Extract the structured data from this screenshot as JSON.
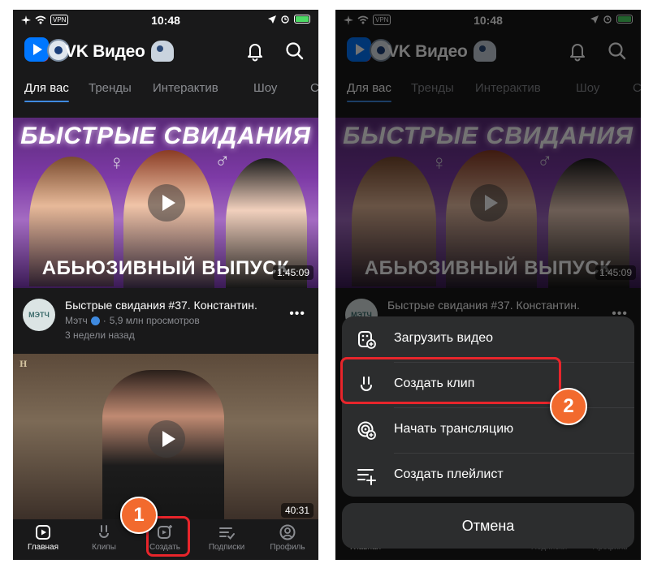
{
  "status": {
    "vpn": "VPN",
    "time": "10:48"
  },
  "header": {
    "brand": "VK Видео"
  },
  "tabs": [
    {
      "label": "Для вас",
      "active": true
    },
    {
      "label": "Тренды"
    },
    {
      "label": "Интерактив"
    },
    {
      "label": "Шоу"
    },
    {
      "label": "С"
    }
  ],
  "video1": {
    "thumb_title": "БЫСТРЫЕ СВИДАНИЯ",
    "thumb_sub": "АБЬЮЗИВНЫЙ ВЫПУСК",
    "duration": "1:45:09",
    "title": "Быстрые свидания #37. Константин.",
    "channel": "Мэтч",
    "views": "5,9 млн просмотров",
    "date": "3 недели назад",
    "avatar_text": "МЭТЧ"
  },
  "video2": {
    "duration": "40:31",
    "watermark": "H"
  },
  "nav": [
    {
      "label": "Главная",
      "active": true
    },
    {
      "label": "Клипы"
    },
    {
      "label": "Создать"
    },
    {
      "label": "Подписки"
    },
    {
      "label": "Профиль"
    }
  ],
  "menu": {
    "items": [
      {
        "label": "Загрузить видео"
      },
      {
        "label": "Создать клип"
      },
      {
        "label": "Начать трансляцию"
      },
      {
        "label": "Создать плейлист"
      }
    ],
    "cancel": "Отмена"
  },
  "annotations": {
    "step1": "1",
    "step2": "2"
  },
  "colors": {
    "accent": "#3f8ae0",
    "highlight": "#e8252b",
    "badge": "#f26a2e",
    "background": "#19191a",
    "sheet": "#2c2d2e"
  }
}
